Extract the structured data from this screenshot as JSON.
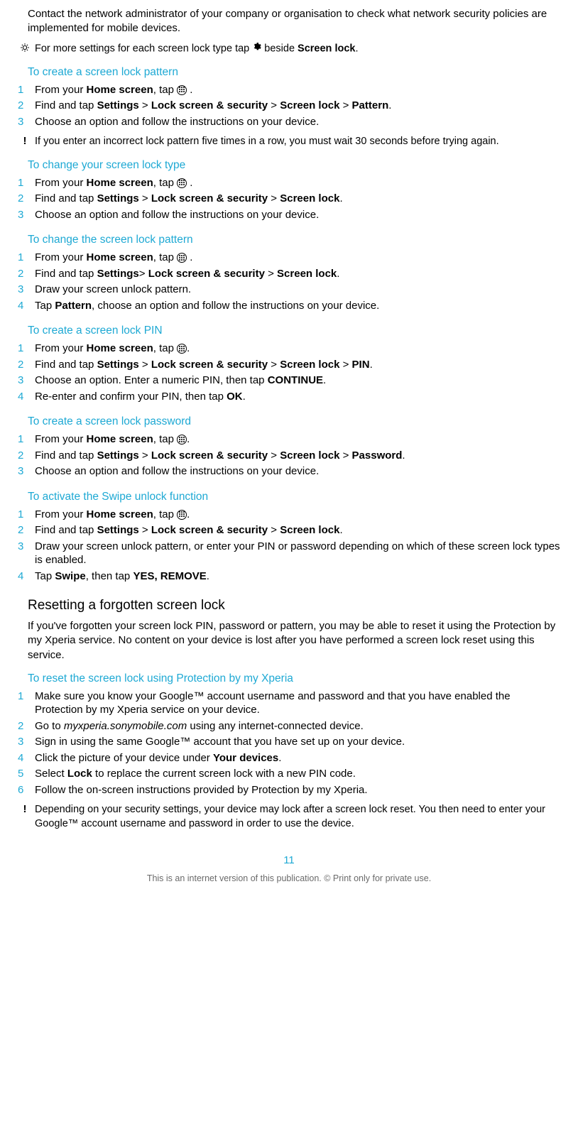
{
  "intro": "Contact the network administrator of your company or organisation to check what network security policies are implemented for mobile devices.",
  "tip1_a": "For more settings for each screen lock type tap ",
  "tip1_b": " beside ",
  "tip1_c": "Screen lock",
  "tip1_d": ".",
  "h1": "To create a screen lock pattern",
  "s1": {
    "n1": "1",
    "l1a": "From your ",
    "l1b": "Home screen",
    "l1c": ", tap ",
    "l1d": " .",
    "n2": "2",
    "l2a": "Find and tap ",
    "l2b": "Settings",
    "l2c": " > ",
    "l2d": "Lock screen & security",
    "l2e": " > ",
    "l2f": "Screen lock",
    "l2g": " > ",
    "l2h": "Pattern",
    "l2i": ".",
    "n3": "3",
    "l3": "Choose an option and follow the instructions on your device."
  },
  "warn1": "If you enter an incorrect lock pattern five times in a row, you must wait 30 seconds before trying again.",
  "h2": "To change your screen lock type",
  "s2": {
    "n1": "1",
    "l1a": "From your ",
    "l1b": "Home screen",
    "l1c": ", tap ",
    "l1d": " .",
    "n2": "2",
    "l2a": "Find and tap ",
    "l2b": "Settings",
    "l2c": " > ",
    "l2d": "Lock screen & security",
    "l2e": " > ",
    "l2f": "Screen lock",
    "l2g": ".",
    "n3": "3",
    "l3": "Choose an option and follow the instructions on your device."
  },
  "h3": "To change the screen lock pattern",
  "s3": {
    "n1": "1",
    "l1a": "From your ",
    "l1b": "Home screen",
    "l1c": ", tap ",
    "l1d": " .",
    "n2": "2",
    "l2a": "Find and tap ",
    "l2b": "Settings",
    "l2c": "> ",
    "l2d": "Lock screen & security",
    "l2e": " > ",
    "l2f": "Screen lock",
    "l2g": ".",
    "n3": "3",
    "l3": "Draw your screen unlock pattern.",
    "n4": "4",
    "l4a": "Tap ",
    "l4b": "Pattern",
    "l4c": ", choose an option and follow the instructions on your device."
  },
  "h4": "To create a screen lock PIN",
  "s4": {
    "n1": "1",
    "l1a": "From your ",
    "l1b": "Home screen",
    "l1c": ", tap ",
    "l1d": ".",
    "n2": "2",
    "l2a": "Find and tap ",
    "l2b": "Settings",
    "l2c": " > ",
    "l2d": "Lock screen & security",
    "l2e": " > ",
    "l2f": "Screen lock",
    "l2g": " > ",
    "l2h": "PIN",
    "l2i": ".",
    "n3": "3",
    "l3a": "Choose an option. Enter a numeric PIN, then tap ",
    "l3b": "CONTINUE",
    "l3c": ".",
    "n4": "4",
    "l4a": "Re-enter and confirm your PIN, then tap ",
    "l4b": "OK",
    "l4c": "."
  },
  "h5": "To create a screen lock password",
  "s5": {
    "n1": "1",
    "l1a": "From your ",
    "l1b": "Home screen",
    "l1c": ", tap ",
    "l1d": ".",
    "n2": "2",
    "l2a": "Find and tap ",
    "l2b": "Settings",
    "l2c": " > ",
    "l2d": "Lock screen & security",
    "l2e": " > ",
    "l2f": "Screen lock",
    "l2g": " > ",
    "l2h": "Password",
    "l2i": ".",
    "n3": "3",
    "l3": "Choose an option and follow the instructions on your device."
  },
  "h6": "To activate the Swipe unlock function",
  "s6": {
    "n1": "1",
    "l1a": "From your ",
    "l1b": "Home screen",
    "l1c": ", tap ",
    "l1d": ".",
    "n2": "2",
    "l2a": "Find and tap ",
    "l2b": "Settings",
    "l2c": " > ",
    "l2d": "Lock screen & security",
    "l2e": " > ",
    "l2f": "Screen lock",
    "l2g": ".",
    "n3": "3",
    "l3": "Draw your screen unlock pattern, or enter your PIN or password depending on which of these screen lock types is enabled.",
    "n4": "4",
    "l4a": "Tap ",
    "l4b": "Swipe",
    "l4c": ", then tap ",
    "l4d": "YES, REMOVE",
    "l4e": "."
  },
  "h7": "Resetting a forgotten screen lock",
  "para7": "If you've forgotten your screen lock PIN, password or pattern, you may be able to reset it using the Protection by my Xperia service. No content on your device is lost after you have performed a screen lock reset using this service.",
  "h8": "To reset the screen lock using Protection by my Xperia",
  "s8": {
    "n1": "1",
    "l1": "Make sure you know your Google™ account username and password and that you have enabled the Protection by my Xperia service on your device.",
    "n2": "2",
    "l2a": "Go to ",
    "l2b": "myxperia.sonymobile.com",
    "l2c": " using any internet-connected device.",
    "n3": "3",
    "l3": "Sign in using the same Google™ account that you have set up on your device.",
    "n4": "4",
    "l4a": "Click the picture of your device under ",
    "l4b": "Your devices",
    "l4c": ".",
    "n5": "5",
    "l5a": "Select ",
    "l5b": "Lock",
    "l5c": " to replace the current screen lock with a new PIN code.",
    "n6": "6",
    "l6": "Follow the on-screen instructions provided by Protection by my Xperia."
  },
  "warn2": "Depending on your security settings, your device may lock after a screen lock reset. You then need to enter your Google™ account username and password in order to use the device.",
  "page_number": "11",
  "footer": "This is an internet version of this publication. © Print only for private use."
}
